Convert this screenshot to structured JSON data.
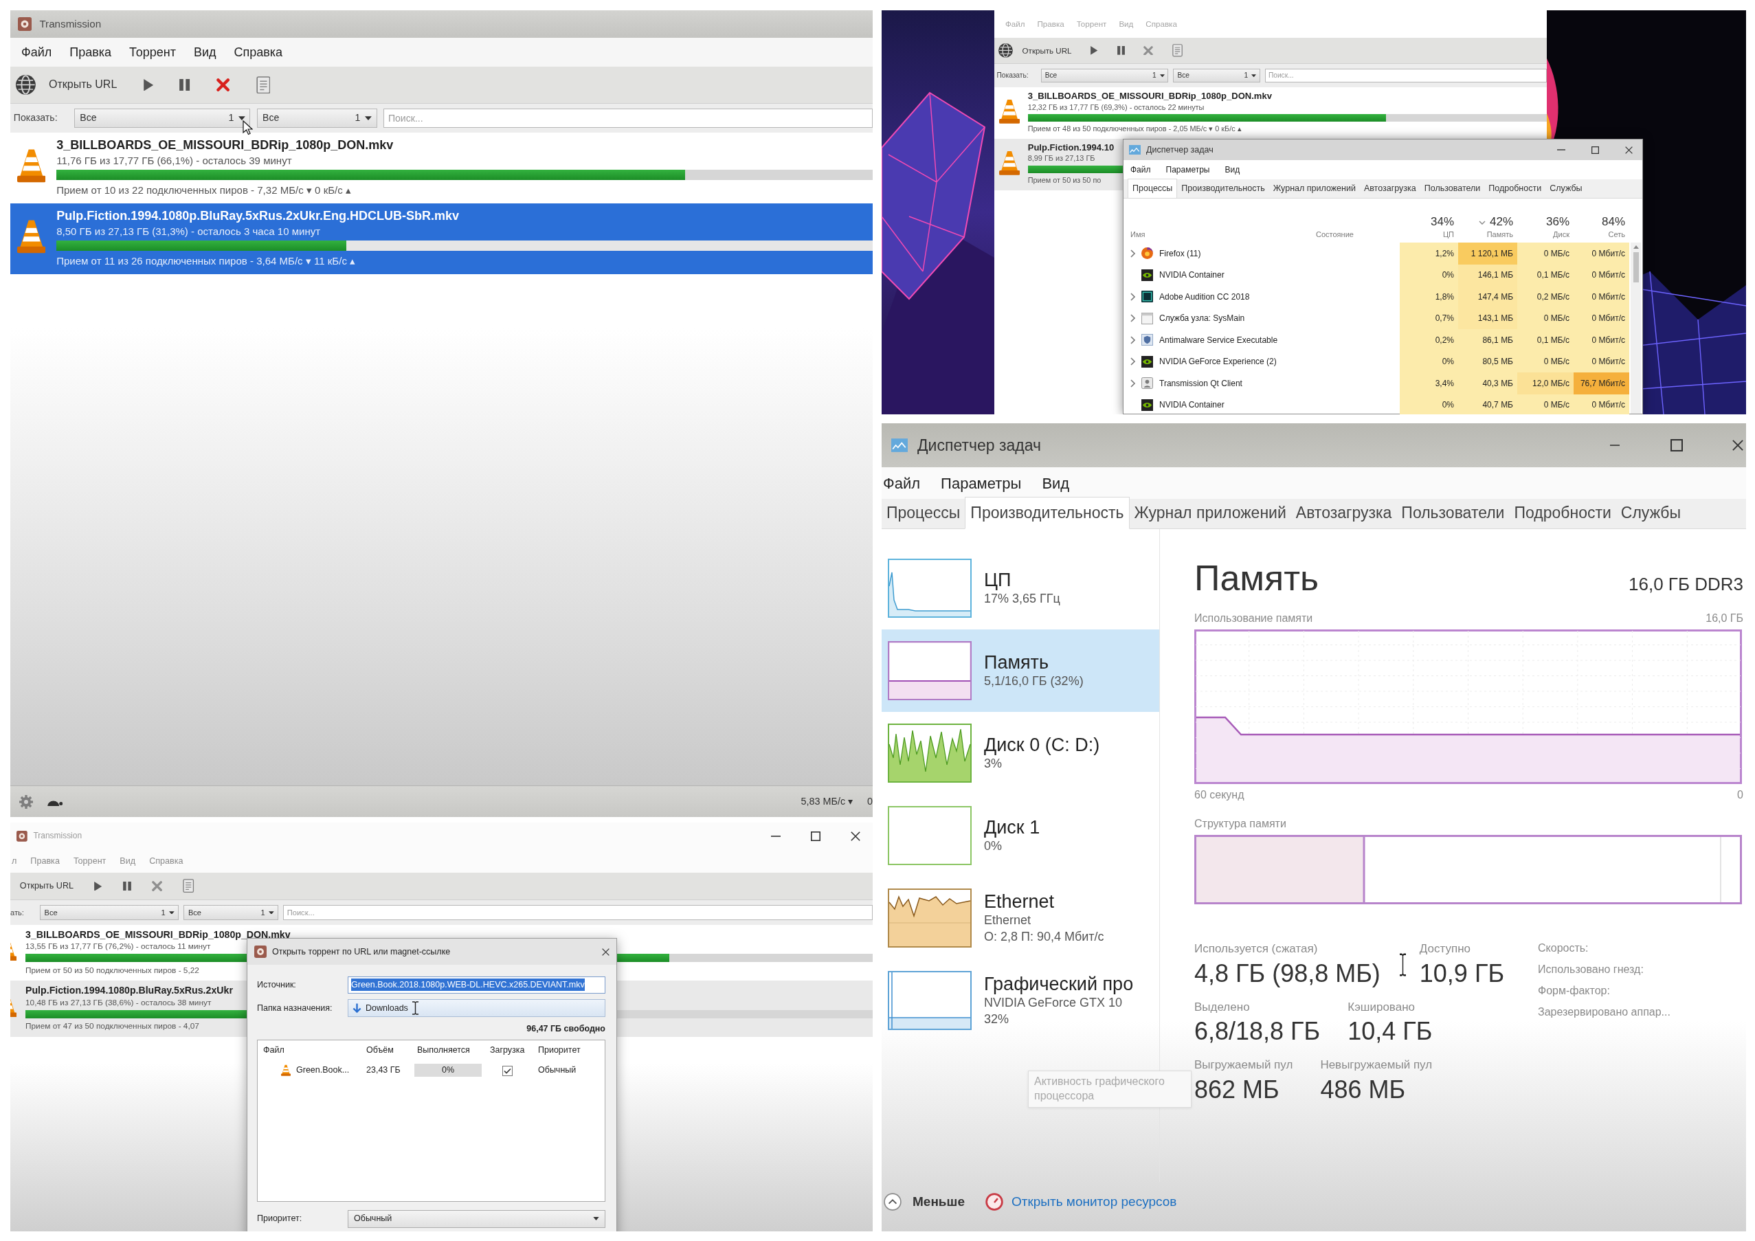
{
  "transmission_window": {
    "title": "Transmission",
    "focused": true,
    "menu": [
      "Файл",
      "Правка",
      "Торрент",
      "Вид",
      "Справка"
    ],
    "toolbar": [
      {
        "kind": "open_url",
        "label": "Открыть URL",
        "disabled": false
      },
      {
        "kind": "start",
        "disabled": false
      },
      {
        "kind": "pause",
        "disabled": false
      },
      {
        "kind": "remove",
        "disabled": false
      },
      {
        "kind": "properties",
        "disabled": false
      }
    ],
    "filter": {
      "label": "Показать:",
      "dropdowns": [
        {
          "value": "Все",
          "count": "1"
        },
        {
          "value": "Все",
          "count": "1"
        }
      ],
      "search": {
        "placeholder": "Поиск..."
      }
    },
    "torrents": [
      {
        "name": "3_BILLBOARDS_OE_MISSOURI_BDRip_1080p_DON.mkv",
        "progress": "11,76 ГБ из 17,77 ГБ (66,1%) - осталось 39 минут",
        "level": 0.77,
        "peers": "Прием от 10 из 22 подключенных пиров - 7,32 МБ/с ▾ 0 кБ/с ▴",
        "selected": false
      },
      {
        "name": "Pulp.Fiction.1994.1080p.BluRay.5xRus.2xUkr.Eng.HDCLUB-SbR.mkv",
        "progress": "8,50 ГБ из 27,13 ГБ (31,3%) - осталось 3 часа 10 минут",
        "level": 0.355,
        "peers": "Прием от 11 из 26 подключенных пиров - 3,64 МБ/с ▾ 11 кБ/с ▴",
        "selected": true
      }
    ],
    "status_bar": {
      "speeds": [
        "5,83 МБ/с ▾",
        "0"
      ]
    }
  },
  "desktop": {
    "transmission_window": {
      "focused": false,
      "menu": [
        "Файл",
        "Правка",
        "Торрент",
        "Вид",
        "Справка"
      ],
      "toolbar": [
        {
          "kind": "open_url",
          "label": "Открыть URL",
          "disabled": false
        },
        {
          "kind": "start",
          "disabled": false
        },
        {
          "kind": "pause",
          "disabled": false
        },
        {
          "kind": "remove",
          "disabled": true
        },
        {
          "kind": "properties",
          "disabled": false
        }
      ],
      "filter": {
        "label": "Показать:",
        "dropdowns": [
          {
            "value": "Все",
            "count": "1"
          },
          {
            "value": "Все",
            "count": "1"
          }
        ],
        "search": {
          "placeholder": "Поиск..."
        }
      },
      "torrents": [
        {
          "name": "3_BILLBOARDS_OE_MISSOURI_BDRip_1080p_DON.mkv",
          "progress": "12,32 ГБ из 17,77 ГБ (69,3%) - осталось 22 минуты",
          "level": 0.69,
          "peers": "Прием от 48 из 50 подключенных пиров - 2,05 МБ/с ▾ 0 кБ/с ▴",
          "selected": false
        },
        {
          "name": "Pulp.Fiction.1994.10",
          "progress": "8,99 ГБ из 27,13 ГБ",
          "level": 1,
          "peers": "Прием от 50 из 50 по",
          "selected": true
        }
      ]
    },
    "task_manager": {
      "title": "Диспетчер задач",
      "menu": [
        "Файл",
        "Параметры",
        "Вид"
      ],
      "tabs": [
        {
          "label": "Процессы",
          "selected": true
        },
        {
          "label": "Производительность",
          "selected": false
        },
        {
          "label": "Журнал приложений",
          "selected": false
        },
        {
          "label": "Автозагрузка",
          "selected": false
        },
        {
          "label": "Пользователи",
          "selected": false
        },
        {
          "label": "Подробности",
          "selected": false
        },
        {
          "label": "Службы",
          "selected": false
        }
      ],
      "columns": [
        {
          "label": "Имя",
          "sorted": false
        },
        {
          "label": "Состояние",
          "sorted": false
        },
        {
          "usage": "34%",
          "label": "ЦП",
          "sorted": false
        },
        {
          "usage": "42%",
          "label": "Память",
          "sorted": true
        },
        {
          "usage": "36%",
          "label": "Диск",
          "sorted": false
        },
        {
          "usage": "84%",
          "label": "Сеть",
          "sorted": false
        }
      ],
      "processes": [
        {
          "name": "Firefox (11)",
          "kind": "globe",
          "expandable": true,
          "cells": [
            {
              "text": "1,2%",
              "color": "#fcebab"
            },
            {
              "text": "1 120,1 МБ",
              "color": "#f9cb5f"
            },
            {
              "text": "0 МБ/с",
              "color": "#fcebab"
            },
            {
              "text": "0 Мбит/с",
              "color": "#fcebab"
            }
          ]
        },
        {
          "name": "NVIDIA Container",
          "kind": "eye",
          "expandable": false,
          "cells": [
            {
              "text": "0%",
              "color": "#fcebab"
            },
            {
              "text": "146,1 МБ",
              "color": "#fce6a0"
            },
            {
              "text": "0,1 МБ/с",
              "color": "#fcebab"
            },
            {
              "text": "0 Мбит/с",
              "color": "#fcebab"
            }
          ]
        },
        {
          "name": "Adobe Audition CC 2018",
          "kind": "square",
          "expandable": true,
          "cells": [
            {
              "text": "1,8%",
              "color": "#fcebab"
            },
            {
              "text": "147,4 МБ",
              "color": "#fce6a0"
            },
            {
              "text": "0,2 МБ/с",
              "color": "#fcebab"
            },
            {
              "text": "0 Мбит/с",
              "color": "#fcebab"
            }
          ]
        },
        {
          "name": "Служба узла: SysMain",
          "kind": "window",
          "expandable": true,
          "cells": [
            {
              "text": "0,7%",
              "color": "#fcebab"
            },
            {
              "text": "143,1 МБ",
              "color": "#fce6a0"
            },
            {
              "text": "0 МБ/с",
              "color": "#fcebab"
            },
            {
              "text": "0 Мбит/с",
              "color": "#fcebab"
            }
          ]
        },
        {
          "name": "Antimalware Service Executable",
          "kind": "shield",
          "expandable": true,
          "cells": [
            {
              "text": "0,2%",
              "color": "#fcebab"
            },
            {
              "text": "86,1 МБ",
              "color": "#fcebab"
            },
            {
              "text": "0,1 МБ/с",
              "color": "#fcebab"
            },
            {
              "text": "0 Мбит/с",
              "color": "#fcebab"
            }
          ]
        },
        {
          "name": "NVIDIA GeForce Experience (2)",
          "kind": "eye",
          "expandable": true,
          "cells": [
            {
              "text": "0%",
              "color": "#fcebab"
            },
            {
              "text": "80,5 МБ",
              "color": "#fcebab"
            },
            {
              "text": "0 МБ/с",
              "color": "#fcebab"
            },
            {
              "text": "0 Мбит/с",
              "color": "#fcebab"
            }
          ]
        },
        {
          "name": "Transmission Qt Client",
          "kind": "app",
          "expandable": true,
          "cells": [
            {
              "text": "3,4%",
              "color": "#fcebab"
            },
            {
              "text": "40,3 МБ",
              "color": "#fcebab"
            },
            {
              "text": "12,0 МБ/с",
              "color": "#fbe196"
            },
            {
              "text": "76,7 Мбит/с",
              "color": "#f5b03c"
            }
          ]
        },
        {
          "name": "NVIDIA Container",
          "kind": "eye",
          "expandable": false,
          "cells": [
            {
              "text": "0%",
              "color": "#fcebab"
            },
            {
              "text": "40,7 МБ",
              "color": "#fcebab"
            },
            {
              "text": "0 МБ/с",
              "color": "#fcebab"
            },
            {
              "text": "0 Мбит/с",
              "color": "#fcebab"
            }
          ]
        }
      ]
    }
  },
  "add_torrent_screen": {
    "transmission_window": {
      "title": "Transmission",
      "window_controls": true,
      "focused": false,
      "menu": [
        "л",
        "Правка",
        "Торрент",
        "Вид",
        "Справка"
      ],
      "toolbar": [
        {
          "kind": "label",
          "label": "Открыть URL",
          "disabled": false
        },
        {
          "kind": "start",
          "disabled": false
        },
        {
          "kind": "pause",
          "disabled": false
        },
        {
          "kind": "remove",
          "disabled": true
        },
        {
          "kind": "properties",
          "disabled": false
        }
      ],
      "filter": {
        "label": "ать:",
        "dropdowns": [
          {
            "value": "Все",
            "count": "1"
          },
          {
            "value": "Все",
            "count": "1"
          }
        ],
        "search": {
          "placeholder": "Поиск..."
        }
      },
      "torrents": [
        {
          "name": "3_BILLBOARDS_OE_MISSOURI_BDRip_1080p_DON.mkv",
          "progress": "13,55 ГБ из 17,77 ГБ (76,2%) - осталось 11 минут",
          "level": 0.76,
          "peers": "Прием от 50 из 50 подключенных пиров - 5,22",
          "selected": false
        },
        {
          "name": "Pulp.Fiction.1994.1080p.BluRay.5xRus.2xUkr",
          "progress": "10,48 ГБ из 27,13 ГБ (38,6%) - осталось 38 минут",
          "level": 0.386,
          "peers": "Прием от 47 из 50 подключенных пиров - 4,07",
          "selected": true
        }
      ]
    },
    "dialog": {
      "title": "Открыть торрент по URL или magnet-ссылке",
      "fields": [
        {
          "kind": "text",
          "label": "Источник:",
          "value": "Green.Book.2018.1080p.WEB-DL.HEVC.x265.DEVIANT.mkv",
          "highlighted": true
        },
        {
          "kind": "folder",
          "label": "Папка назначения:",
          "value": "Downloads",
          "highlighted": false
        }
      ],
      "free_space": "96,47 ГБ свободно",
      "columns": [
        "Файл",
        "Объём",
        "Выполняется",
        "Загрузка",
        "Приоритет"
      ],
      "files": [
        {
          "name": "Green.Book...",
          "size": "23,43 ГБ",
          "progress": "0%",
          "level": 0,
          "checked": true,
          "priority": "Обычный"
        }
      ],
      "priority": {
        "label": "Приоритет:",
        "value": "Обычный"
      }
    }
  },
  "task_manager_performance": {
    "title": "Диспетчер задач",
    "menu": [
      "Файл",
      "Параметры",
      "Вид"
    ],
    "tabs": [
      {
        "label": "Процессы",
        "selected": false
      },
      {
        "label": "Производительность",
        "selected": true
      },
      {
        "label": "Журнал приложений",
        "selected": false
      },
      {
        "label": "Автозагрузка",
        "selected": false
      },
      {
        "label": "Пользователи",
        "selected": false
      },
      {
        "label": "Подробности",
        "selected": false
      },
      {
        "label": "Службы",
        "selected": false
      }
    ],
    "resources": [
      {
        "kind": "cpu",
        "title": "ЦП",
        "details": [
          "17% 3,65 ГГц"
        ],
        "selected": false
      },
      {
        "kind": "memory",
        "title": "Память",
        "details": [
          "5,1/16,0 ГБ (32%)"
        ],
        "selected": true
      },
      {
        "kind": "disk",
        "title": "Диск 0 (C: D:)",
        "details": [
          "3%"
        ],
        "selected": false
      },
      {
        "kind": "idle_disk",
        "title": "Диск 1",
        "details": [
          "0%"
        ],
        "selected": false
      },
      {
        "kind": "ethernet",
        "title": "Ethernet",
        "details": [
          "Ethernet",
          "О: 2,8 П: 90,4 Мбит/с"
        ],
        "selected": false
      },
      {
        "kind": "gpu",
        "title": "Графический про",
        "details": [
          "NVIDIA GeForce GTX 10",
          "32%"
        ],
        "selected": false
      }
    ],
    "memory": {
      "title": "Память",
      "spec": "16,0 ГБ DDR3",
      "usage_label": "Использование памяти",
      "usage_max": "16,0 ГБ",
      "time_span": "60 секунд",
      "usage_min": "0",
      "structure_label": "Структура памяти",
      "stat_rows": [
        {
          "items": [
            {
              "label": "Используется (сжатая)",
              "value": "4,8 ГБ (98,8 МБ)"
            },
            {
              "label": "Доступно",
              "value": "10,9 ГБ"
            }
          ]
        },
        {
          "items": [
            {
              "label": "Выделено",
              "value": "6,8/18,8 ГБ"
            },
            {
              "label": "Кэшировано",
              "value": "10,4 ГБ"
            }
          ]
        },
        {
          "items": [
            {
              "label": "Выгружаемый пул",
              "value": "862 МБ"
            },
            {
              "label": "Невыгружаемый пул",
              "value": "486 МБ"
            }
          ]
        }
      ],
      "properties": [
        "Скорость:",
        "Использовано гнезд:",
        "Форм-фактор:",
        "Зарезервировано аппар..."
      ]
    },
    "tooltip": "Активность графического процессора",
    "footer": {
      "fewer_details": "Меньше",
      "resource_monitor": "Открыть монитор ресурсов"
    }
  }
}
